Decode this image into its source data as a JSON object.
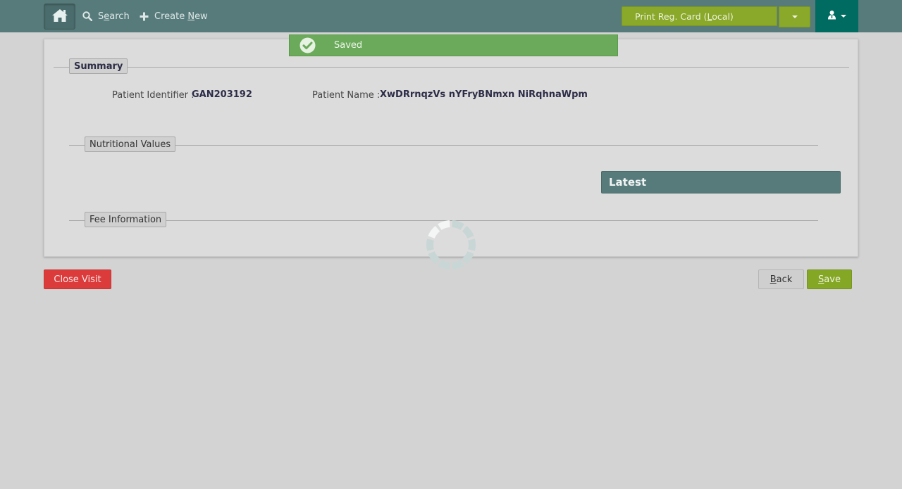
{
  "topbar": {
    "search": {
      "pre": "S",
      "accel": "e",
      "post": "arch"
    },
    "create_new": {
      "pre": "Create ",
      "accel": "N",
      "post": "ew"
    },
    "print_reg_card": {
      "pre": "Print Reg. Card (",
      "accel": "L",
      "post": "ocal)"
    }
  },
  "toast": {
    "message": "Saved"
  },
  "summary": {
    "legend": "Summary",
    "patient_identifier_label": "Patient Identifier :",
    "patient_identifier_value": "GAN203192",
    "patient_name_label": "Patient Name :",
    "patient_name_value": "XwDRrnqzVs nYFryBNmxn NiRqhnaWpm"
  },
  "nutritional": {
    "legend": "Nutritional Values",
    "latest_label": "Latest"
  },
  "fee": {
    "legend": "Fee Information"
  },
  "actions": {
    "close_visit": "Close Visit",
    "back": {
      "accel": "B",
      "post": "ack"
    },
    "save": {
      "accel": "S",
      "post": "ave"
    }
  },
  "colors": {
    "topbar": "#577b7b",
    "user_menu": "#006b60",
    "print_button": "#8aa829",
    "toast": "#6aaa5a",
    "close_visit": "#dc3b3b",
    "save": "#85a726"
  },
  "icons": {
    "home": "home-icon",
    "search": "search-icon",
    "create": "plus-icon",
    "user": "user-icon",
    "toast": "check-circle-icon",
    "loading": "spinner-icon"
  }
}
